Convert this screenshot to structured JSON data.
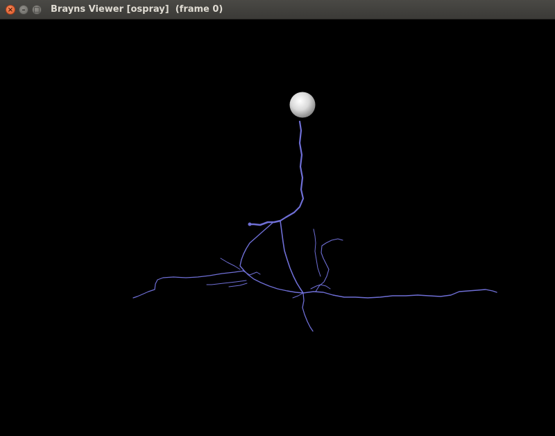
{
  "window": {
    "title": "Brayns Viewer [ospray]  (frame 0)",
    "controls": {
      "close_icon": "close-icon",
      "minimize_icon": "minimize-icon",
      "maximize_icon": "maximize-icon"
    }
  },
  "scene": {
    "background_color": "#000000",
    "soma_color": "#e6e6e6",
    "neurite_color": "#6f6fd6"
  }
}
